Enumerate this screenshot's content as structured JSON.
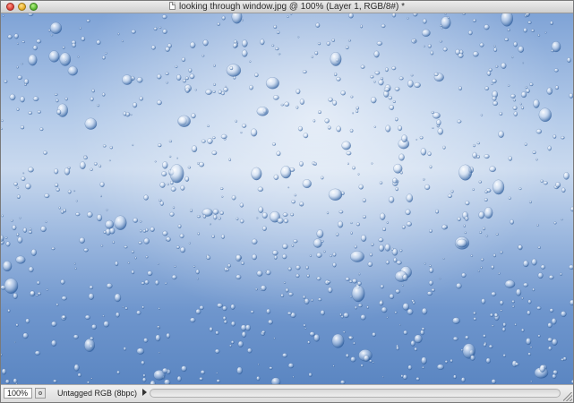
{
  "window": {
    "title": "looking through window.jpg @ 100% (Layer 1, RGB/8#) *"
  },
  "statusbar": {
    "zoom_value": "100%",
    "doc_info": "Untagged RGB (8bpc)"
  },
  "icons": {
    "close": "close-icon",
    "minimize": "minimize-icon",
    "zoom": "zoom-icon",
    "document": "document-icon",
    "info_menu": "triangle-right-icon"
  },
  "colors": {
    "canvas_top": "#7fa3d6",
    "canvas_mid": "#c9d9ee",
    "canvas_bottom": "#5b86c2"
  }
}
